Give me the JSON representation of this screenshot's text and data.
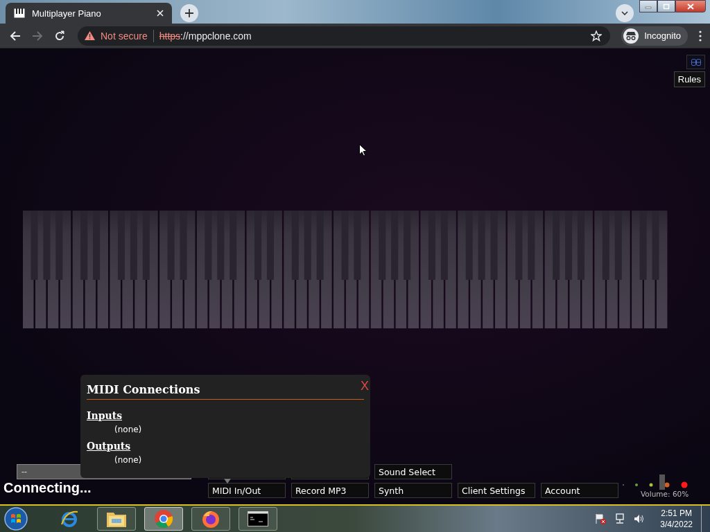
{
  "browser": {
    "tabs": [
      {
        "title": "Multiplayer Piano",
        "selected": true
      }
    ],
    "nav": {
      "forward_disabled": true
    },
    "security": "Not secure",
    "url": {
      "scheme": "https",
      "rest": "://mppclone.com"
    },
    "profile": "Incognito"
  },
  "page": {
    "rules_button": "Rules",
    "modal": {
      "title": "MIDI Connections",
      "close": "X",
      "sections": [
        {
          "heading": "Inputs",
          "items": [
            "(none)"
          ]
        },
        {
          "heading": "Outputs",
          "items": [
            "(none)"
          ]
        }
      ]
    },
    "chat": {
      "value": "--"
    },
    "status": "Connecting...",
    "upper_buttons": [
      "Sound Select"
    ],
    "buttons": [
      {
        "label": "MIDI In/Out",
        "open": true
      },
      {
        "label": "Record MP3",
        "open": false
      },
      {
        "label": "Synth",
        "open": false
      },
      {
        "label": "Client Settings",
        "open": false
      },
      {
        "label": "Account",
        "open": false
      }
    ],
    "volume": {
      "reading": "Volume: 60%"
    }
  },
  "taskbar": {
    "apps": [
      {
        "kind": "ie",
        "running": false,
        "active": false
      },
      {
        "kind": "explorer",
        "running": true,
        "active": false
      },
      {
        "kind": "chrome",
        "running": true,
        "active": true
      },
      {
        "kind": "firefox",
        "running": true,
        "active": false
      },
      {
        "kind": "cmd",
        "running": true,
        "active": false
      }
    ],
    "time": "2:51 PM",
    "date": "3/4/2022"
  }
}
